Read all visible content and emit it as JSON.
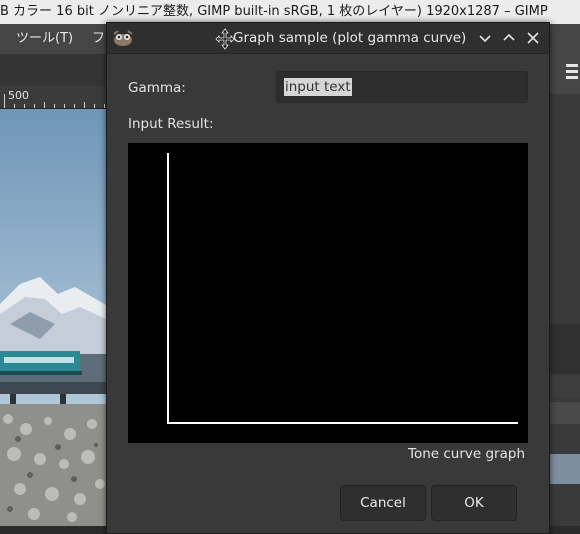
{
  "main_window": {
    "title": "B カラー 16 bit ノンリニア整数, GIMP built-in sRGB, 1 枚のレイヤー) 1920x1287 – GIMP",
    "menu": [
      "ツール(T)",
      "フ"
    ],
    "ruler_label": "500"
  },
  "dialog": {
    "title": "Graph sample (plot gamma curve)",
    "gamma_label": "Gamma:",
    "gamma_value": "input text",
    "result_label": "Input Result:",
    "graph_caption": "Tone curve graph",
    "cancel_label": "Cancel",
    "ok_label": "OK",
    "buttons": [
      "chevron-down-icon",
      "chevron-up-icon",
      "close-icon"
    ]
  },
  "colors": {
    "dialog_bg": "#393939",
    "graph_bg": "#000000",
    "axis": "#ffffff"
  }
}
